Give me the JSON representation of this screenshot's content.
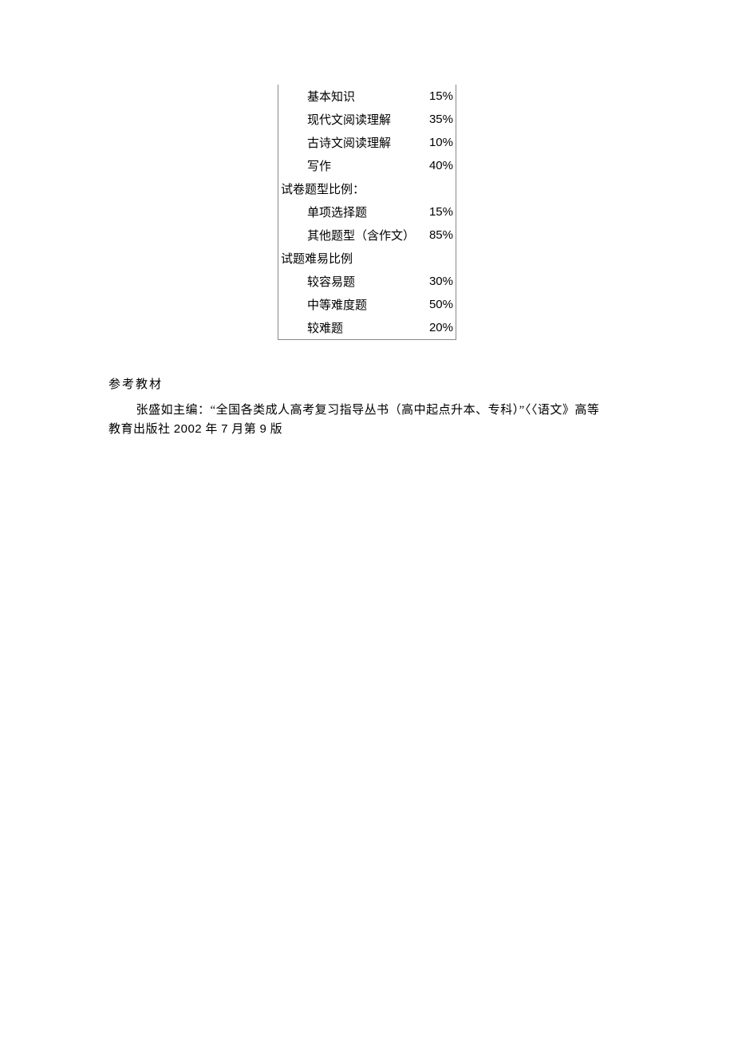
{
  "table": {
    "content_ratio": {
      "rows": [
        {
          "label": "基本知识",
          "value": "15%"
        },
        {
          "label": "现代文阅读理解",
          "value": "35%"
        },
        {
          "label": "古诗文阅读理解",
          "value": "10%"
        },
        {
          "label": "写作",
          "value": "40%"
        }
      ]
    },
    "type_ratio": {
      "header": "试卷题型比例：",
      "rows": [
        {
          "label": "单项选择题",
          "value": "15%"
        },
        {
          "label": "其他题型（含作文）",
          "value": "85%"
        }
      ]
    },
    "difficulty_ratio": {
      "header": "试题难易比例",
      "rows": [
        {
          "label": "较容易题",
          "value": "30%"
        },
        {
          "label": "中等难度题",
          "value": "50%"
        },
        {
          "label": "较难题",
          "value": "20%"
        }
      ]
    }
  },
  "reference": {
    "heading": "参考教材",
    "line1_prefix": "张盛如主编：“全国各类成人高考复习指导丛书（高中起点升本、专科）”〈〈语文》高等",
    "line2_prefix": "教育出版社 ",
    "year": "2002",
    "mid1": " 年 ",
    "month": "7",
    "mid2": " 月第 ",
    "edition": "9",
    "suffix": " 版"
  }
}
